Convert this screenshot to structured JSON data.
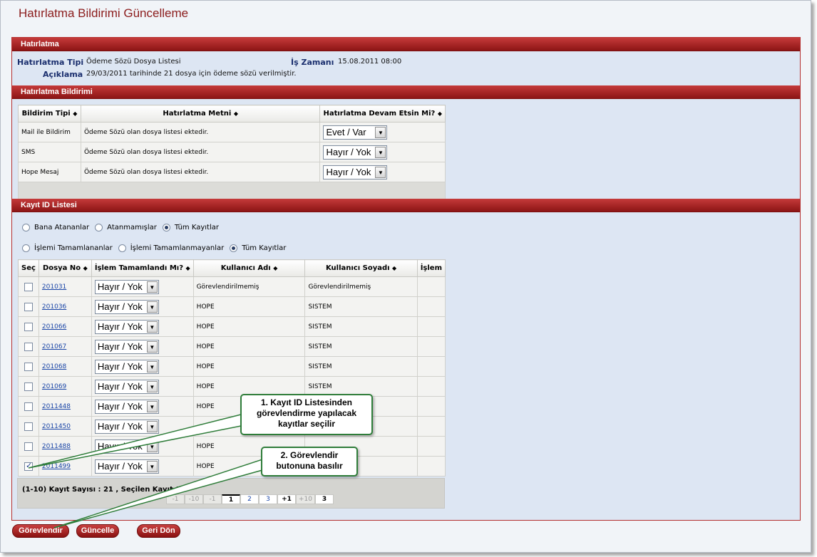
{
  "page": {
    "title": "Hatırlatma Bildirimi Güncelleme"
  },
  "hatirlatma": {
    "header": "Hatırlatma",
    "tip_label": "Hatırlatma Tipi",
    "tip_value": "Ödeme Sözü Dosya Listesi",
    "zaman_label": "İş Zamanı",
    "zaman_value": "15.08.2011 08:00",
    "aciklama_label": "Açıklama",
    "aciklama_value": "29/03/2011 tarihinde 21 dosya için ödeme sözü verilmiştir."
  },
  "bildirim": {
    "header": "Hatırlatma Bildirimi",
    "columns": [
      "Bildirim Tipi",
      "Hatırlatma Metni",
      "Hatırlatma Devam Etsin Mi?"
    ],
    "rows": [
      {
        "tip": "Mail ile Bildirim",
        "metin": "Ödeme Sözü olan dosya listesi ektedir.",
        "devam": "Evet / Var"
      },
      {
        "tip": "SMS",
        "metin": "Ödeme Sözü olan dosya listesi ektedir.",
        "devam": "Hayır / Yok"
      },
      {
        "tip": "Hope Mesaj",
        "metin": "Ödeme Sözü olan dosya listesi ektedir.",
        "devam": "Hayır / Yok"
      }
    ]
  },
  "kayit": {
    "header": "Kayıt ID Listesi",
    "filter1": [
      "Bana Atananlar",
      "Atanmamışlar",
      "Tüm Kayıtlar"
    ],
    "filter2": [
      "İşlemi Tamamlananlar",
      "İşlemi Tamamlanmayanlar",
      "Tüm Kayıtlar"
    ],
    "columns": [
      "Seç",
      "Dosya No",
      "İşlem Tamamlandı Mı?",
      "Kullanıcı Adı",
      "Kullanıcı Soyadı",
      "İşlem"
    ],
    "rows": [
      {
        "dosya": "201031",
        "tamam": "Hayır / Yok",
        "ad": "Görevlendirilmemiş",
        "soyad": "Görevlendirilmemiş",
        "checked": false
      },
      {
        "dosya": "201036",
        "tamam": "Hayır / Yok",
        "ad": "HOPE",
        "soyad": "SISTEM",
        "checked": false
      },
      {
        "dosya": "201066",
        "tamam": "Hayır / Yok",
        "ad": "HOPE",
        "soyad": "SISTEM",
        "checked": false
      },
      {
        "dosya": "201067",
        "tamam": "Hayır / Yok",
        "ad": "HOPE",
        "soyad": "SISTEM",
        "checked": false
      },
      {
        "dosya": "201068",
        "tamam": "Hayır / Yok",
        "ad": "HOPE",
        "soyad": "SISTEM",
        "checked": false
      },
      {
        "dosya": "201069",
        "tamam": "Hayır / Yok",
        "ad": "HOPE",
        "soyad": "SISTEM",
        "checked": false
      },
      {
        "dosya": "2011448",
        "tamam": "Hayır / Yok",
        "ad": "HOPE",
        "soyad": "",
        "checked": false
      },
      {
        "dosya": "2011450",
        "tamam": "Hayır / Yok",
        "ad": "",
        "soyad": "",
        "checked": false
      },
      {
        "dosya": "2011488",
        "tamam": "Hayır / Yok",
        "ad": "HOPE",
        "soyad": "",
        "checked": false
      },
      {
        "dosya": "2011499",
        "tamam": "Hayır / Yok",
        "ad": "HOPE",
        "soyad": "",
        "checked": true
      }
    ],
    "pager_text": "(1-10) Kayıt Sayısı : 21 , Seçilen Kayıt Sa",
    "pager": [
      "-1",
      "-10",
      "-1",
      "1",
      "2",
      "3",
      "+1",
      "+10",
      "3"
    ]
  },
  "buttons": {
    "gorevlendir": "Görevlendir",
    "guncelle": "Güncelle",
    "geri": "Geri Dön"
  },
  "callouts": {
    "c1": "1. Kayıt ID Listesinden görevlendirme yapılacak kayıtlar seçilir",
    "c2": "2. Görevlendir butonuna basılır"
  },
  "colors": {
    "accent": "#8b1c1c",
    "panel": "#dde6f3",
    "callout_border": "#2f7d3a"
  }
}
